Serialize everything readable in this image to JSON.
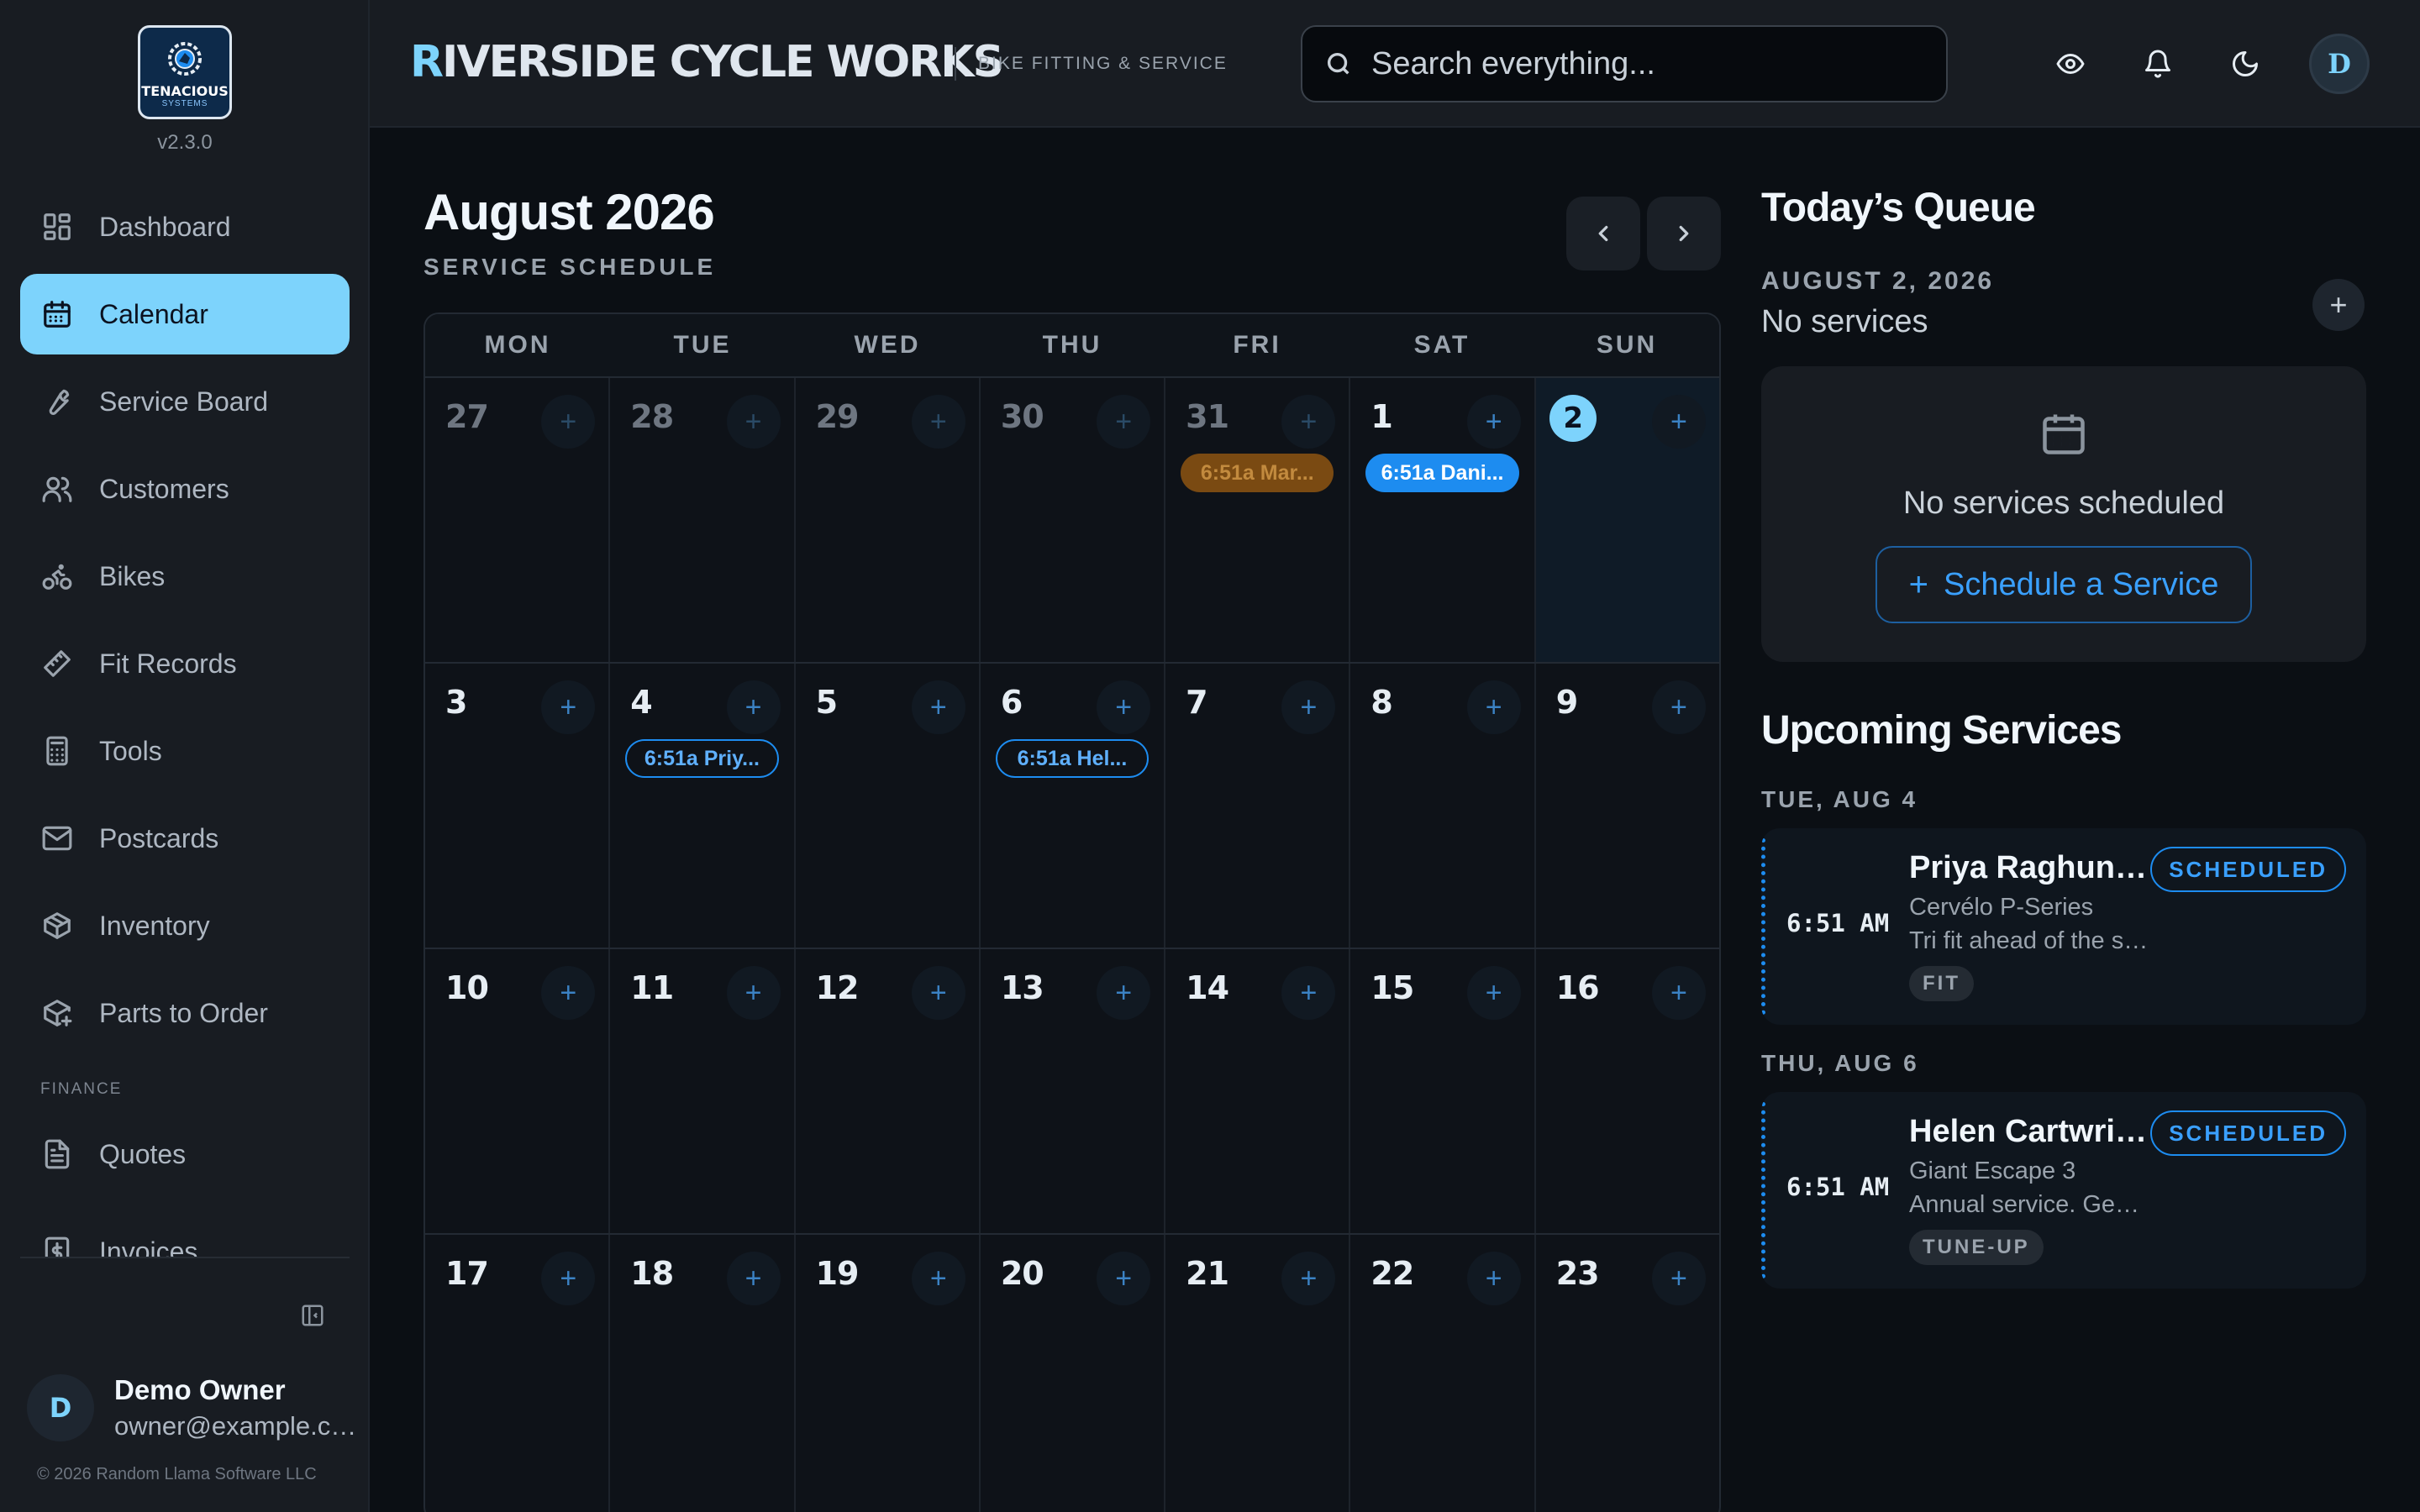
{
  "sidebar": {
    "logo": {
      "text": "TENACIOUS",
      "sub": "SYSTEMS"
    },
    "version": "v2.3.0",
    "items": [
      {
        "label": "Dashboard",
        "icon": "dashboard-icon"
      },
      {
        "label": "Calendar",
        "icon": "calendar-icon",
        "active": true
      },
      {
        "label": "Service Board",
        "icon": "wrench-icon"
      },
      {
        "label": "Customers",
        "icon": "users-icon"
      },
      {
        "label": "Bikes",
        "icon": "bike-icon"
      },
      {
        "label": "Fit Records",
        "icon": "ruler-icon"
      },
      {
        "label": "Tools",
        "icon": "calculator-icon"
      },
      {
        "label": "Postcards",
        "icon": "mail-icon"
      },
      {
        "label": "Inventory",
        "icon": "package-icon"
      },
      {
        "label": "Parts to Order",
        "icon": "package-plus-icon"
      }
    ],
    "finance_label": "FINANCE",
    "finance_items": [
      {
        "label": "Quotes",
        "icon": "file-text-icon"
      },
      {
        "label": "Invoices",
        "icon": "receipt-icon"
      }
    ],
    "user": {
      "initial": "D",
      "name": "Demo Owner",
      "email": "owner@example.com"
    },
    "copyright": "© 2026 Random Llama Software LLC"
  },
  "header": {
    "brand_first": "R",
    "brand_rest": "IVERSIDE CYCLE WORKS",
    "subtitle": "BIKE FITTING & SERVICE",
    "search_placeholder": "Search everything...",
    "avatar_initial": "D"
  },
  "calendar": {
    "title": "August 2026",
    "subtitle": "SERVICE SCHEDULE",
    "weekdays": [
      "MON",
      "TUE",
      "WED",
      "THU",
      "FRI",
      "SAT",
      "SUN"
    ],
    "weeks": [
      [
        {
          "num": "27",
          "other": true
        },
        {
          "num": "28",
          "other": true
        },
        {
          "num": "29",
          "other": true
        },
        {
          "num": "30",
          "other": true
        },
        {
          "num": "31",
          "other": true,
          "event": {
            "label": "6:51a Mar...",
            "style": "muted"
          }
        },
        {
          "num": "1",
          "event": {
            "label": "6:51a Dani...",
            "style": "solid"
          }
        },
        {
          "num": "2",
          "today": true
        }
      ],
      [
        {
          "num": "3"
        },
        {
          "num": "4",
          "event": {
            "label": "6:51a Priy...",
            "style": "outline"
          }
        },
        {
          "num": "5"
        },
        {
          "num": "6",
          "event": {
            "label": "6:51a Hel...",
            "style": "outline"
          }
        },
        {
          "num": "7"
        },
        {
          "num": "8"
        },
        {
          "num": "9"
        }
      ],
      [
        {
          "num": "10"
        },
        {
          "num": "11"
        },
        {
          "num": "12"
        },
        {
          "num": "13"
        },
        {
          "num": "14"
        },
        {
          "num": "15"
        },
        {
          "num": "16"
        }
      ],
      [
        {
          "num": "17"
        },
        {
          "num": "18"
        },
        {
          "num": "19"
        },
        {
          "num": "20"
        },
        {
          "num": "21"
        },
        {
          "num": "22"
        },
        {
          "num": "23"
        }
      ]
    ]
  },
  "queue": {
    "title": "Today’s Queue",
    "date": "AUGUST 2, 2026",
    "status": "No services",
    "empty_text": "No services scheduled",
    "schedule_button": "Schedule a Service"
  },
  "upcoming": {
    "title": "Upcoming Services",
    "groups": [
      {
        "date": "TUE, AUG 4",
        "time": "6:51 AM",
        "name": "Priya Raghunathan",
        "bike": "Cervélo P-Series",
        "note": "Tri fit ahead of the season",
        "tag": "FIT",
        "status": "SCHEDULED"
      },
      {
        "date": "THU, AUG 6",
        "time": "6:51 AM",
        "name": "Helen Cartwright",
        "bike": "Giant Escape 3",
        "note": "Annual service. General check",
        "tag": "TUNE-UP",
        "status": "SCHEDULED"
      }
    ]
  },
  "colors": {
    "accent": "#7dd3fc",
    "primary_blue": "#1d8cf0",
    "background": "#0b0f14",
    "panel": "#181c22"
  }
}
